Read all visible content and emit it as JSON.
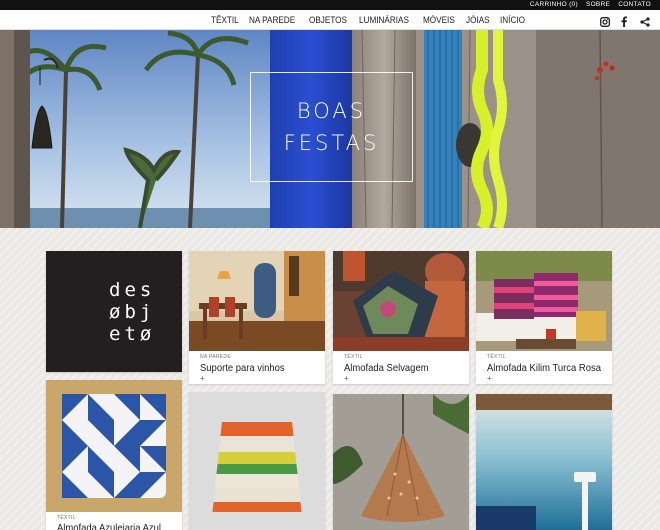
{
  "topbar": {
    "cart": "CARRINHO (0)",
    "about": "SOBRE",
    "contact": "CONTATO"
  },
  "nav": {
    "items": [
      "TÊXTIL",
      "NA PAREDE",
      "OBJETOS",
      "LUMINÁRIAS",
      "MÓVEIS",
      "JÓIAS",
      "INÍCIO"
    ]
  },
  "social": {
    "icons": [
      "instagram-icon",
      "facebook-icon",
      "share-icon"
    ]
  },
  "hero": {
    "line1": "BOAS",
    "line2": "FESTAS"
  },
  "logo": {
    "line1": "des",
    "line2": "øbj",
    "line3": "etø"
  },
  "products": [
    {
      "category": "NA PAREDE",
      "name": "Suporte para vinhos",
      "more": "+"
    },
    {
      "category": "TÊXTIL",
      "name": "Almofada Selvagem",
      "more": "+"
    },
    {
      "category": "TÊXTIL",
      "name": "Almofada Kilim Turca Rosa",
      "more": "+"
    },
    {
      "category": "TÊXTIL",
      "name": "Almofada Azulejaria Azul",
      "more": "+"
    }
  ],
  "colors": {
    "topbar": "#111111",
    "background": "#ebe9e6",
    "logo_tile": "#231f20"
  }
}
